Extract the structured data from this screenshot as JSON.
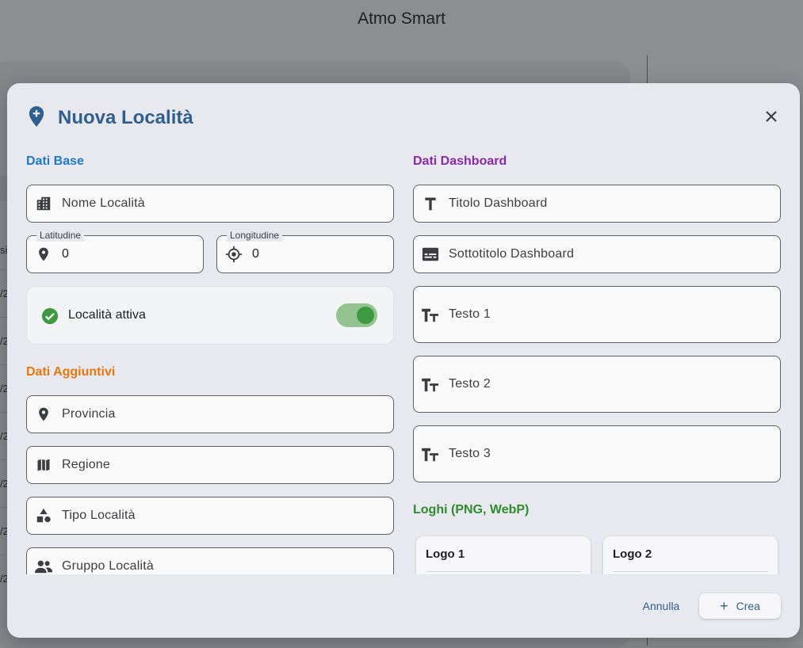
{
  "app": {
    "title": "Atmo Smart"
  },
  "background": {
    "row_labels": [
      "si",
      "/2",
      "/2",
      "/2",
      "/2",
      "/2",
      "/2",
      "/2"
    ]
  },
  "dialog": {
    "title": "Nuova Località",
    "sections": {
      "base": {
        "title": "Dati Base",
        "color": "#1f78c8"
      },
      "additional": {
        "title": "Dati Aggiuntivi",
        "color": "#e8760e"
      },
      "dashboard": {
        "title": "Dati Dashboard",
        "color": "#8a2aa6"
      },
      "logos": {
        "title": "Loghi (PNG, WebP)",
        "color": "#2e8b2e"
      }
    },
    "fields": {
      "location_name": {
        "placeholder": "Nome Località",
        "icon": "building-icon"
      },
      "latitude": {
        "label": "Latitudine",
        "value": "0",
        "icon": "location-pin-icon"
      },
      "longitude": {
        "label": "Longitudine",
        "value": "0",
        "icon": "crosshair-icon"
      },
      "province": {
        "placeholder": "Provincia",
        "icon": "location-pin-icon"
      },
      "region": {
        "placeholder": "Regione",
        "icon": "map-icon"
      },
      "location_type": {
        "placeholder": "Tipo Località",
        "icon": "shapes-icon"
      },
      "location_group": {
        "placeholder": "Gruppo Località",
        "icon": "group-icon"
      },
      "dashboard_title": {
        "placeholder": "Titolo Dashboard",
        "icon": "title-icon"
      },
      "dashboard_subtitle": {
        "placeholder": "Sottotitolo Dashboard",
        "icon": "subtitles-icon"
      },
      "text1": {
        "placeholder": "Testo 1",
        "icon": "text-fields-icon"
      },
      "text2": {
        "placeholder": "Testo 2",
        "icon": "text-fields-icon"
      },
      "text3": {
        "placeholder": "Testo 3",
        "icon": "text-fields-icon"
      }
    },
    "active_toggle": {
      "label": "Località attiva",
      "on": true,
      "accent": "#3e9a41"
    },
    "logos": [
      {
        "label": "Logo 1"
      },
      {
        "label": "Logo 2"
      }
    ],
    "footer": {
      "cancel_label": "Annulla",
      "create_label": "Crea"
    },
    "accent": "#2f5f8f"
  }
}
